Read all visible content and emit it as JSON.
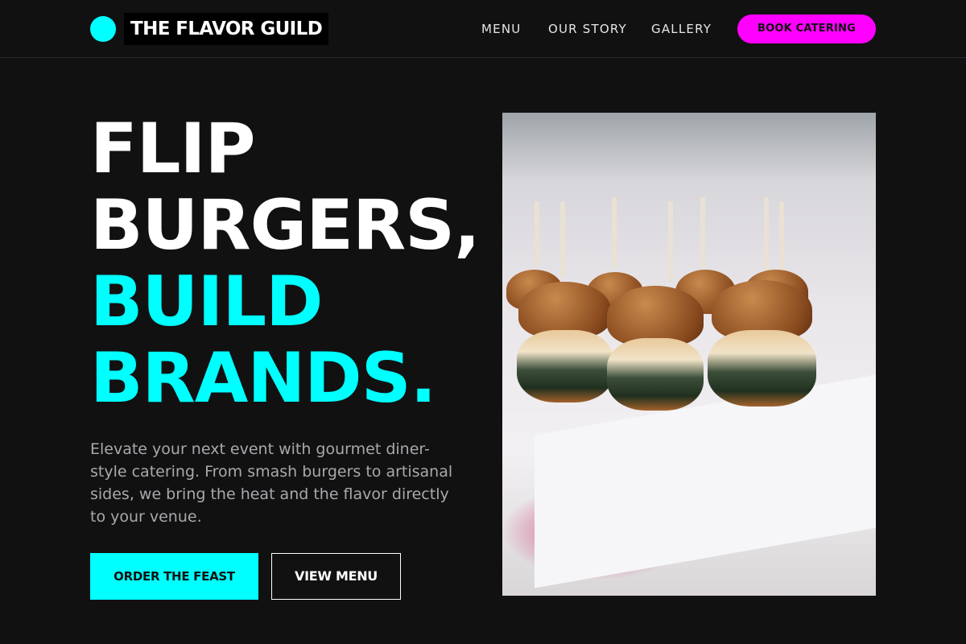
{
  "brand": {
    "name": "THE FLAVOR GUILD",
    "accent_color": "#00ffff",
    "cta_color": "#ff00ff"
  },
  "nav": {
    "links": [
      "MENU",
      "OUR STORY",
      "GALLERY"
    ],
    "cta_label": "BOOK CATERING"
  },
  "hero": {
    "headline_white": [
      "FLIP",
      "BURGERS,"
    ],
    "headline_cyan": [
      "BUILD",
      "BRANDS."
    ],
    "subtitle": "Elevate your next event with gourmet diner-style catering. From smash burgers to artisanal sides, we bring the heat and the flavor directly to your venue.",
    "primary_button": "ORDER THE FEAST",
    "secondary_button": "VIEW MENU",
    "image_subject": "slider-burgers-photo"
  }
}
